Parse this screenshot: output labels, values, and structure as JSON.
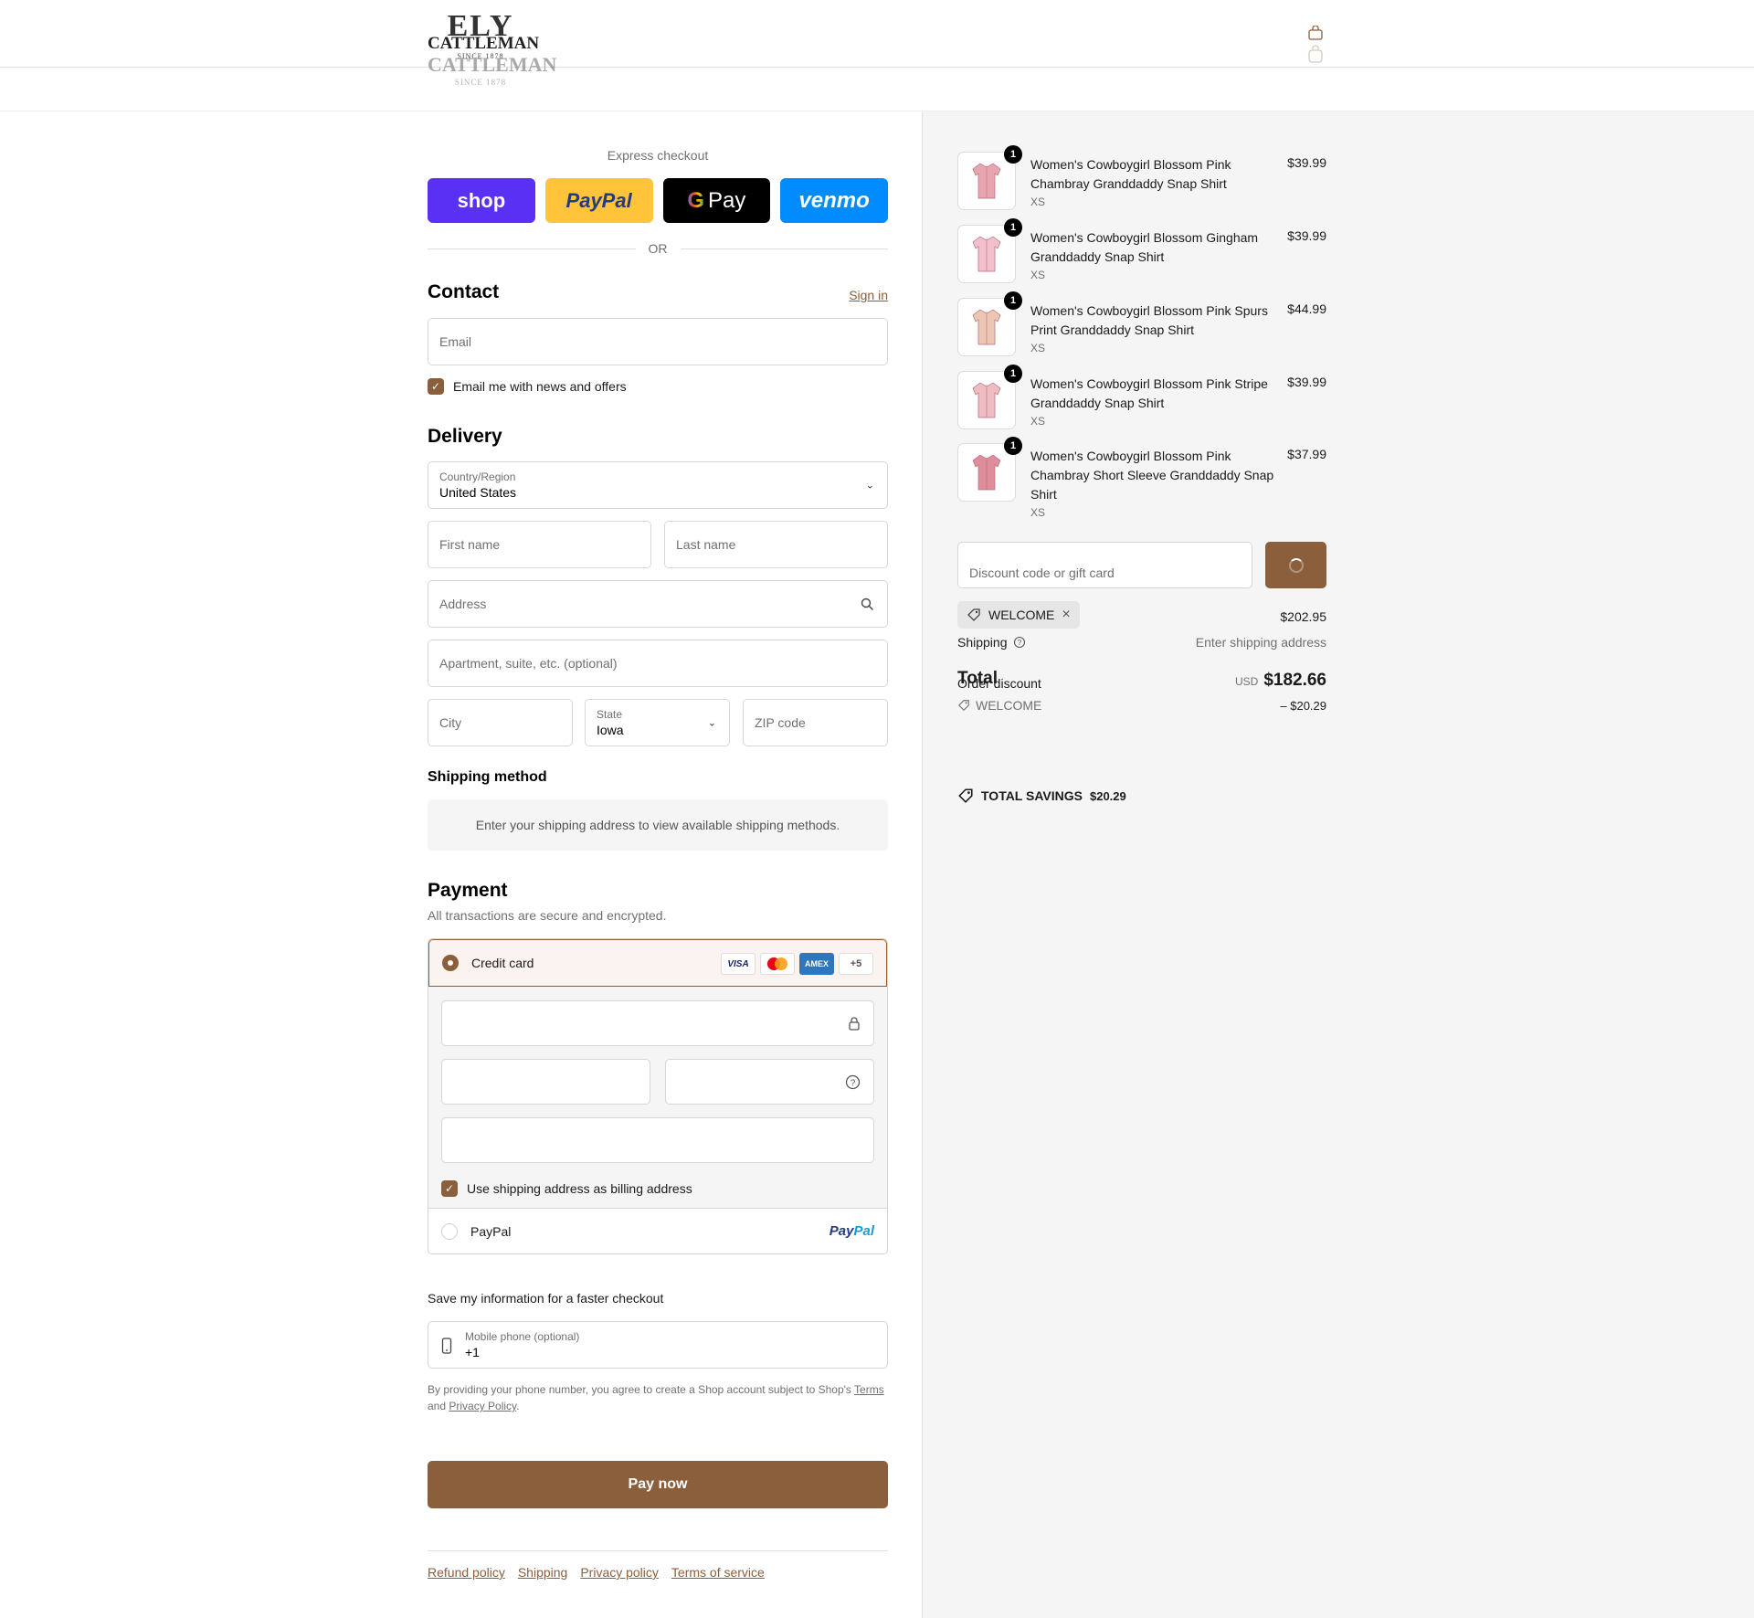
{
  "brand": {
    "logo_top": "ELY",
    "logo_name": "CATTLEMAN",
    "logo_since": "SINCE 1878",
    "ghost_name": "CATTLEMAN",
    "ghost_since": "SINCE 1878"
  },
  "express": {
    "title": "Express checkout",
    "buttons": [
      "shop",
      "PayPal",
      "Pay",
      "venmo"
    ],
    "or": "OR"
  },
  "contact": {
    "heading": "Contact",
    "sign_in": "Sign in",
    "email_placeholder": "Email",
    "newsletter_label": "Email me with news and offers",
    "newsletter_checked": true
  },
  "delivery": {
    "heading": "Delivery",
    "country_label": "Country/Region",
    "country_value": "United States",
    "first_name": "First name",
    "last_name": "Last name",
    "address": "Address",
    "apartment": "Apartment, suite, etc. (optional)",
    "city": "City",
    "state_label": "State",
    "state_value": "Iowa",
    "zip": "ZIP code"
  },
  "shipping_method": {
    "heading": "Shipping method",
    "message": "Enter your shipping address to view available shipping methods."
  },
  "payment": {
    "heading": "Payment",
    "subtitle": "All transactions are secure and encrypted.",
    "credit_card_label": "Credit card",
    "card_brands": [
      "VISA",
      "Mastercard",
      "AMEX",
      "+5"
    ],
    "billing_label": "Use shipping address as billing address",
    "billing_checked": true,
    "paypal_label": "PayPal",
    "paypal_logo_a": "Pay",
    "paypal_logo_b": "Pal"
  },
  "save_info": {
    "heading": "Save my information for a faster checkout",
    "phone_label": "Mobile phone (optional)",
    "phone_value": "+1",
    "legal_a": "By providing your phone number, you agree to create a Shop account subject to Shop's",
    "terms": "Terms",
    "legal_and": "and",
    "privacy": "Privacy Policy",
    "legal_end": "."
  },
  "pay_now": "Pay now",
  "footer_links": [
    "Refund policy",
    "Shipping",
    "Privacy policy",
    "Terms of service"
  ],
  "cart": {
    "items": [
      {
        "name": "Women's Cowboygirl Blossom Pink Chambray Granddaddy Snap Shirt",
        "size": "XS",
        "price": "$39.99",
        "qty": "1",
        "color": "#e7a5b0"
      },
      {
        "name": "Women's Cowboygirl Blossom Gingham Granddaddy Snap Shirt",
        "size": "XS",
        "price": "$39.99",
        "qty": "1",
        "color": "#f2c0cc"
      },
      {
        "name": "Women's Cowboygirl Blossom Pink Spurs Print Granddaddy Snap Shirt",
        "size": "XS",
        "price": "$44.99",
        "qty": "1",
        "color": "#ecc6b4"
      },
      {
        "name": "Women's Cowboygirl Blossom Pink Stripe Granddaddy Snap Shirt",
        "size": "XS",
        "price": "$39.99",
        "qty": "1",
        "color": "#eebcc2"
      },
      {
        "name": "Women's Cowboygirl Blossom Pink Chambray Short Sleeve Granddaddy Snap Shirt",
        "size": "XS",
        "price": "$37.99",
        "qty": "1",
        "color": "#de8e9a"
      }
    ],
    "discount_placeholder": "Discount code or gift card",
    "applied_code": "WELCOME",
    "subtotal": "$202.95",
    "shipping_label": "Shipping",
    "shipping_value": "Enter shipping address",
    "total_label": "Total",
    "order_discount_label": "Order discount",
    "currency": "USD",
    "total_value": "$182.66",
    "discount_code_line": "WELCOME",
    "discount_amount": "– $20.29",
    "savings_label": "TOTAL SAVINGS",
    "savings_value": "$20.29"
  },
  "colors": {
    "accent": "#8b5e3c",
    "shop": "#5a31f4",
    "paypal": "#ffc439",
    "venmo": "#008cff"
  }
}
